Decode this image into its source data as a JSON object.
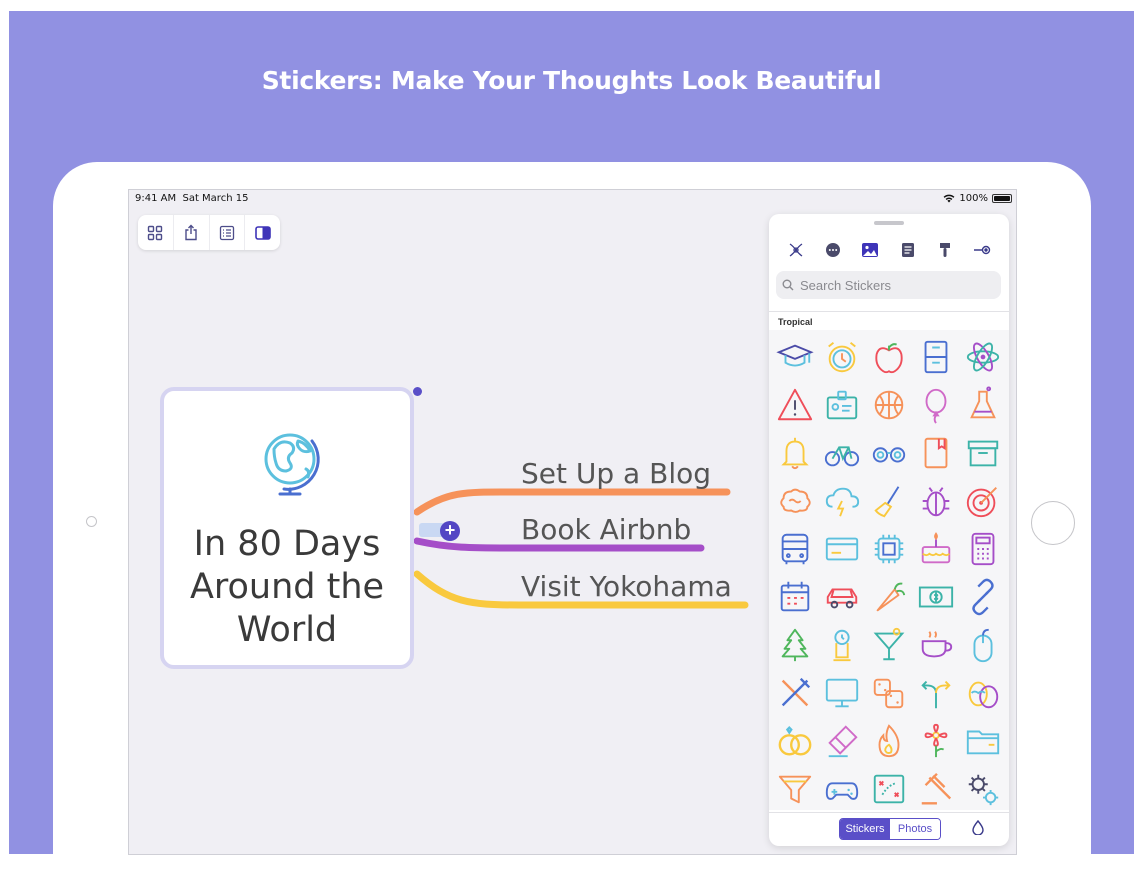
{
  "headline": "Stickers: Make Your Thoughts Look Beautiful",
  "status_bar": {
    "time": "9:41 AM",
    "date": "Sat March 15",
    "battery": "100%"
  },
  "toolbar": {
    "buttons": [
      "grid-view",
      "share",
      "outline-view",
      "format-panel"
    ]
  },
  "mind_map": {
    "central_topic": {
      "line1": "In 80 Days",
      "line2": "Around the",
      "line3": "World",
      "sticker": "globe"
    },
    "branches": [
      {
        "label": "Set Up a Blog",
        "color": "#f6925a"
      },
      {
        "label": "Book Airbnb",
        "color": "#a54ec8"
      },
      {
        "label": "Visit Yokohama",
        "color": "#f9c93e"
      }
    ],
    "add_button": "+"
  },
  "sticker_panel": {
    "tabs": [
      "relationship",
      "more",
      "stickers",
      "notes",
      "style",
      "connect"
    ],
    "active_tab": "stickers",
    "search_placeholder": "Search Stickers",
    "section_title": "Tropical",
    "stickers": [
      "graduation-cap",
      "alarm-clock",
      "apple",
      "filing-cabinet",
      "atom",
      "warning",
      "id-badge",
      "basketball",
      "balloon",
      "flask",
      "bell",
      "bicycle",
      "binoculars",
      "book",
      "storage-box",
      "brain",
      "storm-cloud",
      "broom",
      "bug",
      "target",
      "bus",
      "credit-card",
      "cpu-chip",
      "cake",
      "calculator",
      "calendar",
      "car",
      "carrot",
      "dollar-bill",
      "link",
      "christmas-tree",
      "clock-tower",
      "cocktail",
      "coffee-cup",
      "mouse",
      "fork-knife",
      "monitor",
      "dice",
      "directions",
      "eggs",
      "rings",
      "eraser",
      "fire",
      "flower",
      "folder",
      "funnel",
      "gamepad",
      "strategy-board",
      "gavel",
      "gears"
    ],
    "segment": {
      "stickers": "Stickers",
      "photos": "Photos",
      "active": "Stickers"
    }
  },
  "colors": {
    "accent": "#5a4fc8",
    "banner": "#9191e2"
  }
}
